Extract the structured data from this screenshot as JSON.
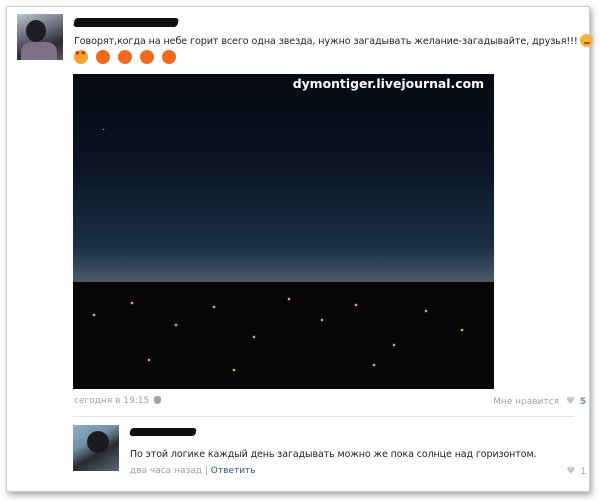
{
  "post": {
    "text": "Говорят,когда на небе горит всего одна звезда, нужно загадывать желание-загадывайте, друзья!!!",
    "emojis": [
      "heart-eyes-icon",
      "heart-icon",
      "heart-icon",
      "heart-icon",
      "heart-icon"
    ],
    "watermark": "dymontiger.livejournal.com",
    "timestamp": "сегодня в 19:15",
    "likes_label": "Мне нравится",
    "likes_count": "5"
  },
  "comment": {
    "text": "По этой логике каждый день загадывать можно же пока солнце над горизонтом.",
    "time": "два часа назад",
    "separator": "|",
    "reply_label": "Ответить",
    "likes_count": "1"
  },
  "colors": {
    "link": "#2b587a",
    "meta": "#9aa3ad",
    "sunset_orange": "#f16a36"
  }
}
